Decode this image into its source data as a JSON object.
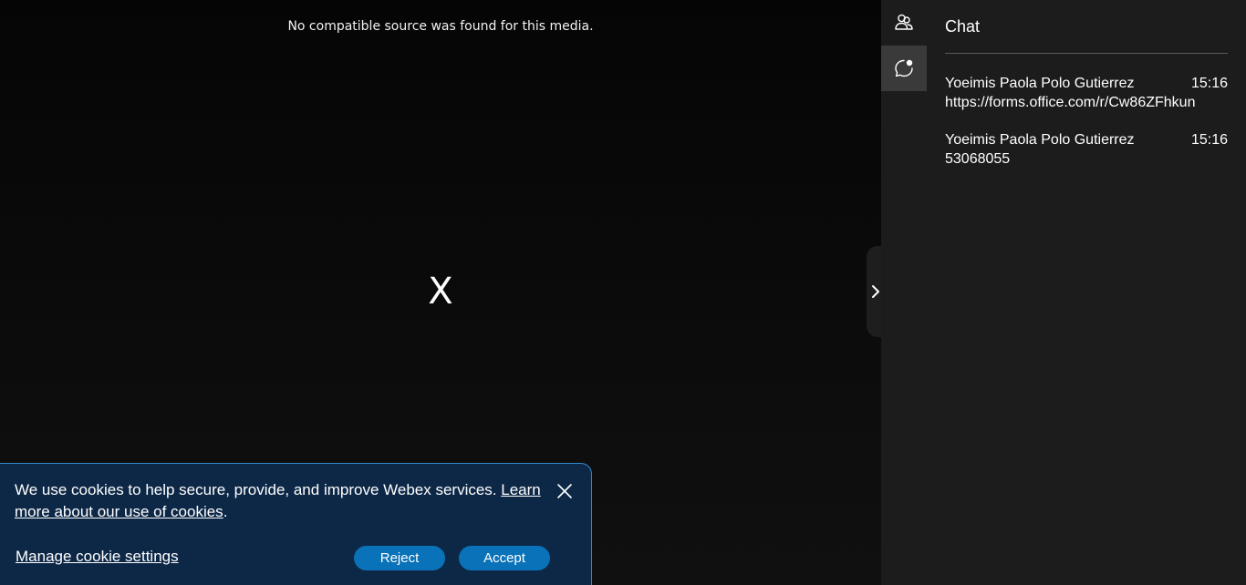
{
  "video": {
    "error_text": "No compatible source was found for this media.",
    "close_glyph": "X"
  },
  "side_panel": {
    "rail": [
      {
        "icon": "participants-icon",
        "active": false
      },
      {
        "icon": "chat-icon",
        "active": true
      }
    ],
    "chat": {
      "title": "Chat",
      "messages": [
        {
          "sender": "Yoeimis Paola Polo Gutierrez",
          "time": "15:16",
          "text": "https://forms.office.com/r/Cw86ZFhkun"
        },
        {
          "sender": "Yoeimis Paola Polo Gutierrez",
          "time": "15:16",
          "text": "53068055"
        }
      ]
    }
  },
  "cookie_banner": {
    "text": "We use cookies to help secure, provide, and improve Webex services. ",
    "learn_more_link": "Learn more about our use of cookies",
    "trailing_period": ".",
    "manage_link": "Manage cookie settings",
    "reject_label": "Reject",
    "accept_label": "Accept"
  },
  "colors": {
    "banner_bg": "#0d2847",
    "banner_border": "#2e8bc9",
    "button_bg": "#0a72b8",
    "panel_bg": "#1c1c1c"
  }
}
